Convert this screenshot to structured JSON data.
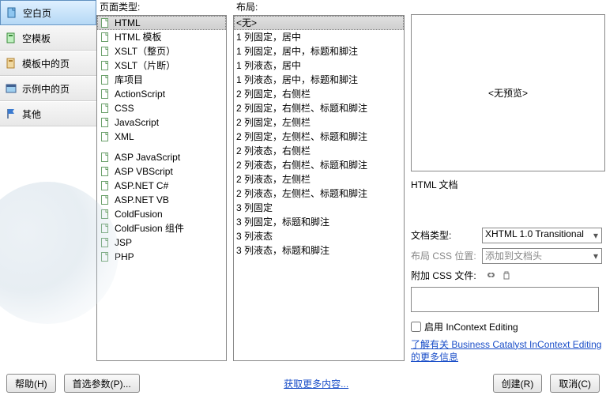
{
  "left_nav": {
    "items": [
      {
        "label": "空白页",
        "icon": "page-blank-icon",
        "selected": true
      },
      {
        "label": "空模板",
        "icon": "template-blank-icon",
        "selected": false
      },
      {
        "label": "模板中的页",
        "icon": "page-from-template-icon",
        "selected": false
      },
      {
        "label": "示例中的页",
        "icon": "sample-page-icon",
        "selected": false
      },
      {
        "label": "其他",
        "icon": "flag-icon",
        "selected": false
      }
    ]
  },
  "page_type": {
    "header": "页面类型:",
    "items_group1": [
      "HTML",
      "HTML 模板",
      "XSLT（整页）",
      "XSLT（片断）",
      "库项目",
      "ActionScript",
      "CSS",
      "JavaScript",
      "XML"
    ],
    "items_group2": [
      "ASP JavaScript",
      "ASP VBScript",
      "ASP.NET C#",
      "ASP.NET VB",
      "ColdFusion",
      "ColdFusion 组件",
      "JSP",
      "PHP"
    ],
    "selected": "HTML"
  },
  "layout": {
    "header": "布局:",
    "items": [
      "<无>",
      "1 列固定，居中",
      "1 列固定，居中，标题和脚注",
      "1 列液态，居中",
      "1 列液态，居中，标题和脚注",
      "2 列固定，右侧栏",
      "2 列固定，右侧栏、标题和脚注",
      "2 列固定，左侧栏",
      "2 列固定，左侧栏、标题和脚注",
      "2 列液态，右侧栏",
      "2 列液态，右侧栏、标题和脚注",
      "2 列液态，左侧栏",
      "2 列液态，左侧栏、标题和脚注",
      "3 列固定",
      "3 列固定，标题和脚注",
      "3 列液态",
      "3 列液态，标题和脚注"
    ],
    "selected": "<无>"
  },
  "preview": {
    "text": "<无预览>",
    "desc": "HTML 文档"
  },
  "settings": {
    "doctype_label": "文档类型:",
    "doctype_value": "XHTML 1.0 Transitional",
    "csspos_label": "布局 CSS 位置:",
    "csspos_value": "添加到文档头",
    "attach_label": "附加 CSS 文件:",
    "incontext_label": "启用 InContext Editing",
    "incontext_link": "了解有关 Business Catalyst InContext Editing 的更多信息"
  },
  "bottom": {
    "help": "帮助(H)",
    "prefs": "首选参数(P)...",
    "get_more": "获取更多内容...",
    "create": "创建(R)",
    "cancel": "取消(C)"
  }
}
